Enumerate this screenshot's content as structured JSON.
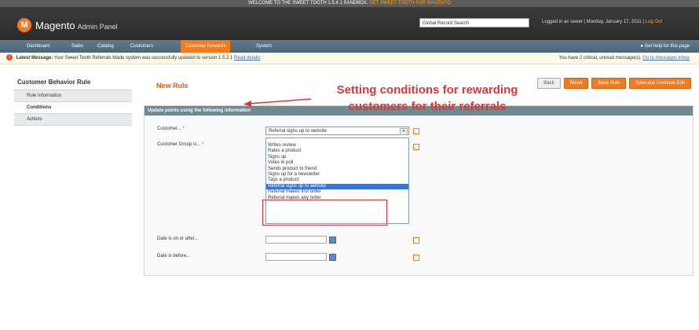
{
  "top_strip": {
    "text": "WELCOME TO THE SWEET TOOTH 1.5.4.1 SANDBOX.",
    "highlight": "GET SWEET TOOTH FOR MAGENTO"
  },
  "header": {
    "logo_text": "Magento",
    "logo_sub": "Admin Panel",
    "search_value": "Global Record Search",
    "user_info": "Logged in as sweet | Monday, January 17, 2011 |",
    "logout": "Log Out"
  },
  "nav": {
    "items": [
      "Dashboard",
      "Sales",
      "Catalog",
      "Customers",
      "Customer Rewards",
      "System"
    ],
    "active_index": 4,
    "help": "Get help for this page"
  },
  "message": {
    "label": "Latest Message:",
    "text": "Your Sweet Tooth Referrals Made system was successfully updated to version 1.5.2.1",
    "link": "Read details",
    "right": "You have 2 critical, unread message(s).",
    "right_link": "Go to messages inbox"
  },
  "sidebar": {
    "title": "Customer Behavior Rule",
    "tabs": [
      "Rule Information",
      "Conditions",
      "Actions"
    ],
    "active_tab": 1
  },
  "page": {
    "title": "New Rule",
    "buttons": [
      "Back",
      "Reset",
      "Save Rule",
      "Save and Continue Edit"
    ]
  },
  "form": {
    "section_title": "Update points using the following information",
    "action_label": "Customer...",
    "action_value": "Referral signs up to website",
    "group_label": "Customer Group is...",
    "options": [
      "Writes review",
      "Rates a product",
      "Signs up",
      "Votes in poll",
      "Sends product to friend",
      "Signs up for a newsletter",
      "Tags a product",
      "Referral signs up to website",
      "Referral makes first order",
      "Referral makes any order"
    ],
    "selected_option": 7,
    "from_label": "Date is on or after...",
    "to_label": "Date is before..."
  },
  "annotation": {
    "line1": "Setting conditions for rewarding",
    "line2": "customers for their referrals"
  },
  "colors": {
    "accent": "#f27b20",
    "annotation": "#d93838",
    "nav": "#5f7b8c",
    "section_head": "#6f8992"
  }
}
